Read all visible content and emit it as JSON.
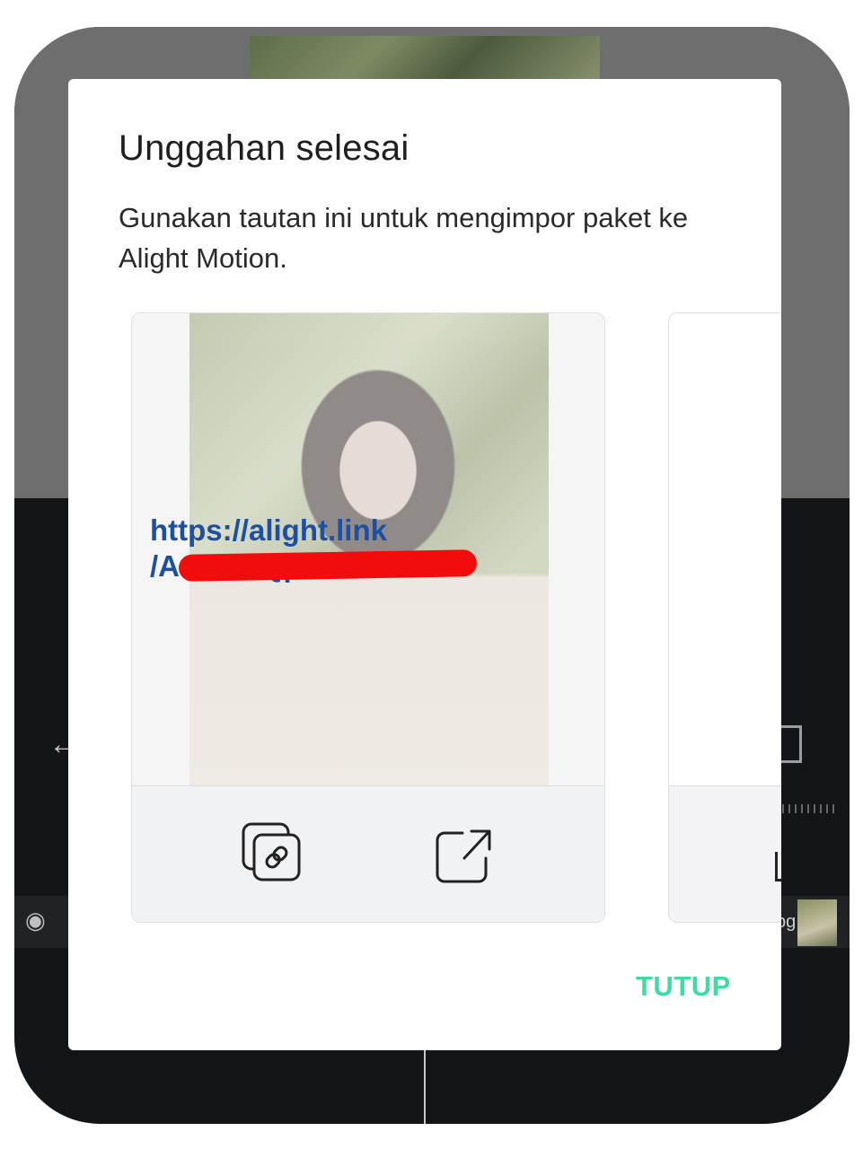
{
  "dialog": {
    "title": "Unggahan selesai",
    "message": "Gunakan tautan ini untuk mengimpor paket ke Alight Motion.",
    "close_label": "TUTUP",
    "accent_color": "#3ddca0"
  },
  "card": {
    "link_line_1": "https://alight.link",
    "link_line_2": "/Aukk…Qp88",
    "link_color": "#1d4fa3",
    "copy_icon": "copy-link-icon",
    "share_icon": "share-icon"
  },
  "background": {
    "layer_label": "pg"
  }
}
